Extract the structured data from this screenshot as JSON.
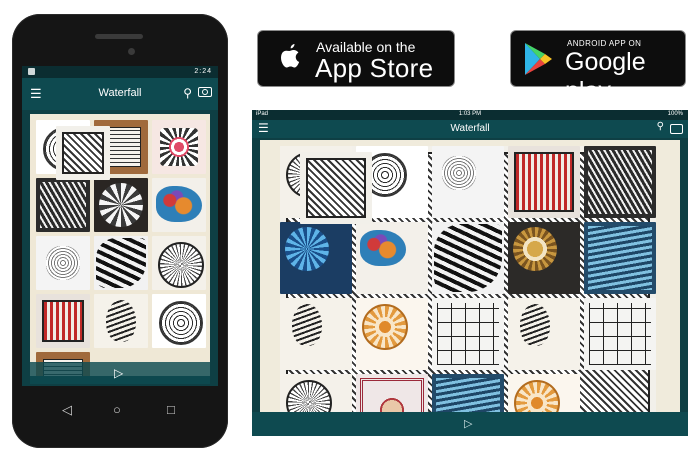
{
  "phone": {
    "status": {
      "time": "2:24"
    },
    "header": {
      "title": "Waterfall",
      "menu_icon": "hamburger-icon",
      "search_icon": "search-icon",
      "camera_icon": "camera-icon"
    },
    "tiles": [
      "grid",
      "circle",
      "wood",
      "pink",
      "dark",
      "dome",
      "color",
      "light",
      "zebra",
      "round",
      "red",
      "feather",
      "grid",
      "circle",
      "wood"
    ],
    "play_icon": "play-icon",
    "nav": {
      "back_icon": "back-icon",
      "home_icon": "home-icon",
      "recents_icon": "recents-icon"
    }
  },
  "badges": {
    "app_store": {
      "line1": "Available on the",
      "line2": "App Store"
    },
    "google_play": {
      "line1": "ANDROID APP ON",
      "line2": "Google play"
    }
  },
  "tablet": {
    "status": {
      "left": "iPad",
      "time": "1:03 PM",
      "right": "100%"
    },
    "header": {
      "title": "Waterfall",
      "menu_icon": "hamburger-icon",
      "search_icon": "search-icon",
      "camera_icon": "camera-icon"
    },
    "tiles": [
      "round",
      "circle",
      "light",
      "red",
      "dark",
      "blue",
      "color",
      "zebra",
      "gold",
      "teal",
      "feather",
      "orange",
      "squares",
      "feather",
      "squares",
      "round",
      "fancy",
      "teal",
      "orange",
      "grid"
    ],
    "play_icon": "play-icon"
  },
  "colors": {
    "app_dark": "#0e3f44",
    "app_header": "#0e4a50",
    "canvas": "#efe8d6"
  }
}
